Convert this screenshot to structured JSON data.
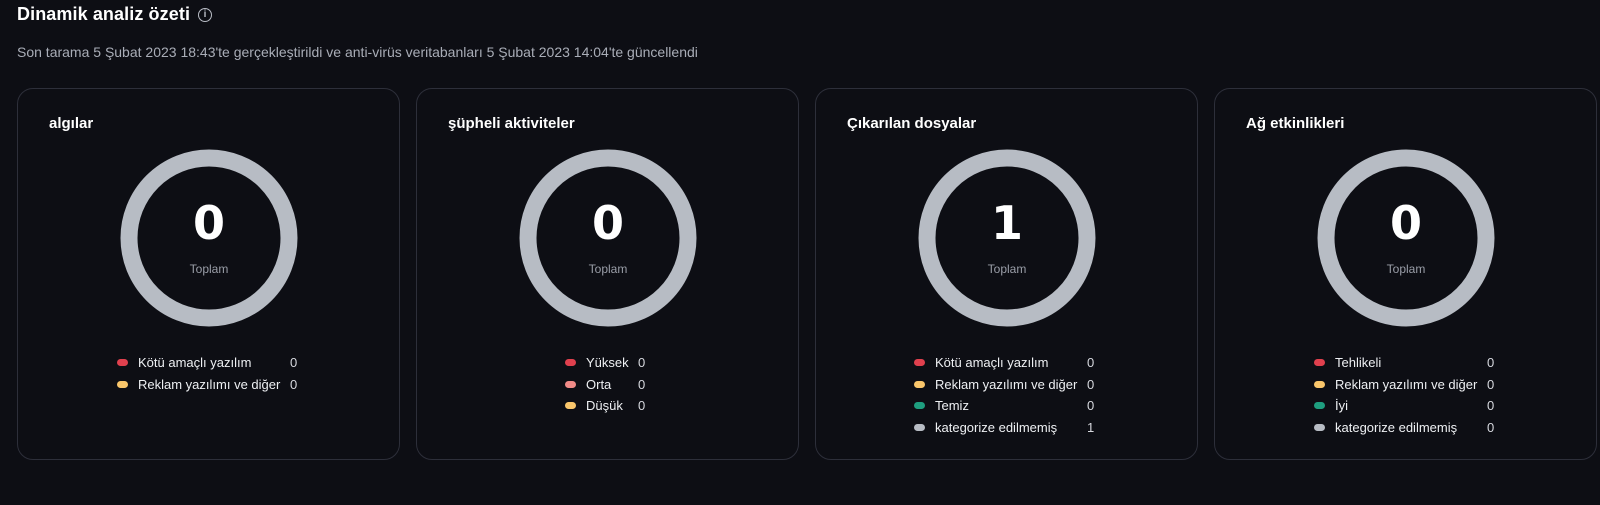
{
  "page": {
    "title": "Dinamik analiz özeti",
    "info_icon": "i",
    "subtitle": "Son tarama 5 Şubat 2023 18:43'te gerçekleştirildi ve anti-virüs veritabanları 5 Şubat 2023 14:04'te güncellendi"
  },
  "colors": {
    "red": "#e0404e",
    "orange": "#f9c66b",
    "salmon": "#f08a87",
    "green": "#1e9e7f",
    "gray": "#b7bcc4",
    "ring": "#b7bcc4"
  },
  "cards": [
    {
      "title": "algılar",
      "total": "0",
      "total_label": "Toplam",
      "items": [
        {
          "label": "Kötü amaçlı yazılım",
          "count": "0",
          "color": "#e0404e"
        },
        {
          "label": "Reklam yazılımı ve diğer",
          "count": "0",
          "color": "#f9c66b"
        }
      ]
    },
    {
      "title": "şüpheli aktiviteler",
      "total": "0",
      "total_label": "Toplam",
      "items": [
        {
          "label": "Yüksek",
          "count": "0",
          "color": "#e0404e"
        },
        {
          "label": "Orta",
          "count": "0",
          "color": "#f08a87"
        },
        {
          "label": "Düşük",
          "count": "0",
          "color": "#f9c66b"
        }
      ]
    },
    {
      "title": "Çıkarılan dosyalar",
      "total": "1",
      "total_label": "Toplam",
      "items": [
        {
          "label": "Kötü amaçlı yazılım",
          "count": "0",
          "color": "#e0404e"
        },
        {
          "label": "Reklam yazılımı ve diğer",
          "count": "0",
          "color": "#f9c66b"
        },
        {
          "label": "Temiz",
          "count": "0",
          "color": "#1e9e7f"
        },
        {
          "label": "kategorize edilmemiş",
          "count": "1",
          "color": "#b7bcc4"
        }
      ]
    },
    {
      "title": "Ağ etkinlikleri",
      "total": "0",
      "total_label": "Toplam",
      "items": [
        {
          "label": "Tehlikeli",
          "count": "0",
          "color": "#e0404e"
        },
        {
          "label": "Reklam yazılımı ve diğer",
          "count": "0",
          "color": "#f9c66b"
        },
        {
          "label": "İyi",
          "count": "0",
          "color": "#1e9e7f"
        },
        {
          "label": "kategorize edilmemiş",
          "count": "0",
          "color": "#b7bcc4"
        }
      ]
    }
  ]
}
